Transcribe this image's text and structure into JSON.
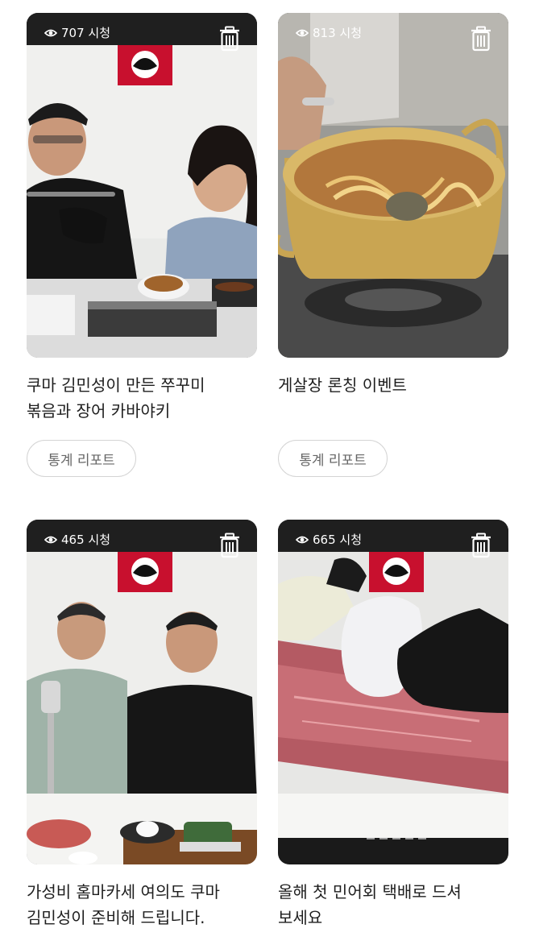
{
  "videos": [
    {
      "views": "707 시청",
      "title_lines": [
        "쿠마 김민성이 만든 쭈꾸미",
        "볶음과 장어 카바야키"
      ],
      "report_label": "통계 리포트"
    },
    {
      "views": "813 시청",
      "title_lines": [
        "게살장 론칭 이벤트",
        ""
      ],
      "report_label": "통계 리포트"
    },
    {
      "views": "465 시청",
      "title_lines": [
        "가성비 홈마카세 여의도 쿠마",
        "김민성이 준비해 드립니다."
      ],
      "report_label": ""
    },
    {
      "views": "665 시청",
      "title_lines": [
        "올해 첫 민어회 택배로 드셔",
        "보세요"
      ],
      "report_label": ""
    }
  ],
  "icons": {
    "views": "eye-icon",
    "delete": "trash-icon"
  },
  "colors": {
    "topbar": "#1f1f1f",
    "logo_red": "#c8102e",
    "button_border": "#d4d4d4"
  }
}
